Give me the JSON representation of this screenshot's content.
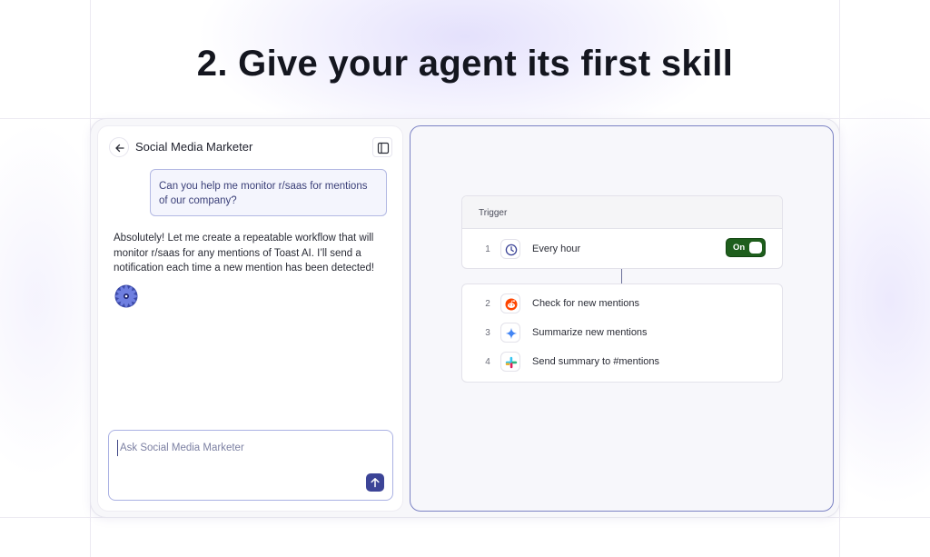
{
  "headline": "2. Give your agent its first skill",
  "chat": {
    "title": "Social Media Marketer",
    "user_message": "Can you help me monitor r/saas for mentions of our company?",
    "agent_message": "Absolutely! Let me create a repeatable workflow that will monitor r/saas for any mentions of Toast AI. I’ll send a notification each time a new mention has been detected!",
    "composer_placeholder": "Ask Social Media Marketer"
  },
  "workflow": {
    "trigger": {
      "header": "Trigger",
      "step": {
        "number": "1",
        "icon": "clock-icon",
        "label": "Every hour"
      },
      "toggle_label": "On",
      "toggle_on": true
    },
    "actions": [
      {
        "number": "2",
        "icon": "reddit-icon",
        "label": "Check for new mentions"
      },
      {
        "number": "3",
        "icon": "sparkle-icon",
        "label": "Summarize new mentions"
      },
      {
        "number": "4",
        "icon": "slack-icon",
        "label": "Send summary to #mentions"
      }
    ]
  },
  "colors": {
    "accent": "#3c4497",
    "toggle_on": "#1e5e1c",
    "user_bubble_border": "#b3b9e3",
    "workflow_border": "#7c83c4"
  }
}
